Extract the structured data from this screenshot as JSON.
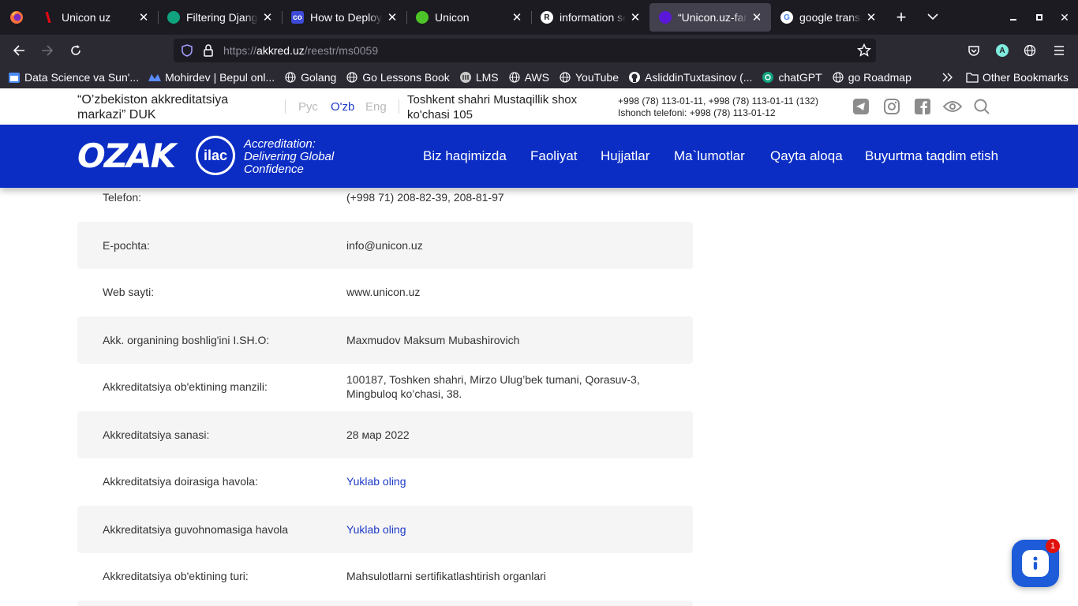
{
  "browser": {
    "tabs": [
      {
        "title": "Unicon uz",
        "icon": "netflix-like-red-icon"
      },
      {
        "title": "Filtering Django",
        "icon": "chatgpt-icon"
      },
      {
        "title": "How to Deploy",
        "icon": "codelabs-icon"
      },
      {
        "title": "Unicon",
        "icon": "green-globe-icon"
      },
      {
        "title": "information serv",
        "icon": "r-icon"
      },
      {
        "title": "“Unicon.uz-fan-",
        "icon": "purple-icon"
      },
      {
        "title": "google translate",
        "icon": "google-icon"
      }
    ],
    "url": {
      "scheme": "https://",
      "host": "akkred.uz",
      "path": "/reestr/ms0059"
    },
    "bookmarks": [
      "Data Science va Sun'...",
      "Mohirdev | Bepul onl...",
      "Golang",
      "Go Lessons Book",
      "LMS",
      "AWS",
      "YouTube",
      "AsliddinTuxtasinov (...",
      "chatGPT",
      "go Roadmap"
    ],
    "other_bookmarks": "Other Bookmarks",
    "profile_initial": "A"
  },
  "header": {
    "org_name": "“O’zbekiston akkreditatsiya markazi” DUK",
    "languages": [
      "Рус",
      "O'zb",
      "Eng"
    ],
    "address": "Toshkent shahri Mustaqillik shox ko'chasi 105",
    "phones": "+998 (78) 113-01-11, +998 (78) 113-01-11 (132)",
    "trust_phone": "Ishonch telefoni: +998 (78) 113-01-12"
  },
  "nav": {
    "logo": "OZAK",
    "ilac": "ilac",
    "tagline": [
      "Accreditation:",
      "Delivering Global",
      "Confidence"
    ],
    "menu": [
      "Biz haqimizda",
      "Faoliyat",
      "Hujjatlar",
      "Ma`lumotlar",
      "Qayta aloqa",
      "Buyurtma taqdim etish"
    ]
  },
  "rows": [
    {
      "label": "Telefon:",
      "value": "(+998 71) 208-82-39, 208-81-97"
    },
    {
      "label": "E-pochta:",
      "value": "info@unicon.uz"
    },
    {
      "label": "Web sayti:",
      "value": "www.unicon.uz"
    },
    {
      "label": "Akk. organining boshlig'ini I.SH.O:",
      "value": "Maxmudov Maksum Mubashirovich"
    },
    {
      "label": "Akkreditatsiya ob'ektining manzili:",
      "value": "100187, Toshken shahri, Mirzo Ulug’bek tumani, Qorasuv-3, Mingbuloq ko’chasi, 38."
    },
    {
      "label": "Akkreditatsiya sanasi:",
      "value": "28 мар 2022"
    },
    {
      "label": "Akkreditatsiya doirasiga havola:",
      "value": "Yuklab oling"
    },
    {
      "label": "Akkreditatsiya guvohnomasiga havola",
      "value": "Yuklab oling"
    },
    {
      "label": "Akkreditatsiya ob'ektining turi:",
      "value": "Mahsulotlarni sertifikatlashtirish organlari"
    }
  ],
  "chat_badge": "1"
}
